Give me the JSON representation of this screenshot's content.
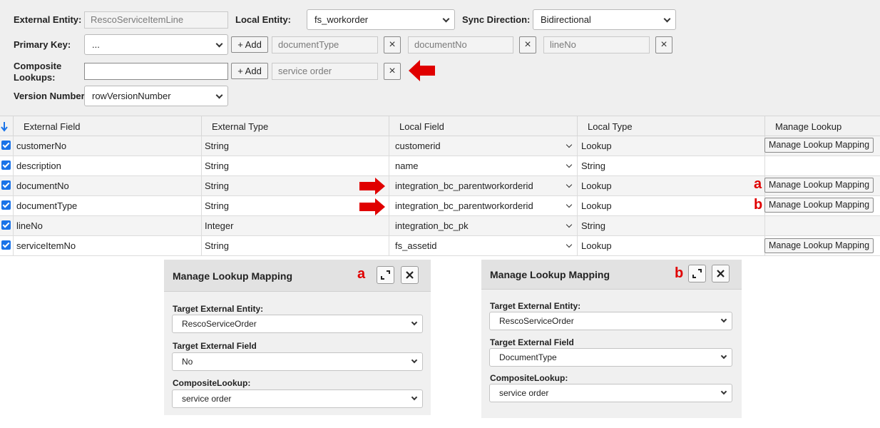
{
  "form": {
    "external_entity_label": "External Entity:",
    "external_entity_value": "RescoServiceItemLine",
    "local_entity_label": "Local Entity:",
    "local_entity_value": "fs_workorder",
    "sync_direction_label": "Sync Direction:",
    "sync_direction_value": "Bidirectional",
    "primary_key_label": "Primary Key:",
    "primary_key_value": "...",
    "add_label": "+ Add",
    "primary_keys": [
      "documentType",
      "documentNo",
      "lineNo"
    ],
    "composite_label_1": "Composite",
    "composite_label_2": "Lookups:",
    "composite_input_value": "",
    "composite_keys": [
      "service order"
    ],
    "version_number_label": "Version Number:",
    "version_number_value": "rowVersionNumber",
    "remove_glyph": "×"
  },
  "table": {
    "sort_icon": "sort-down-icon",
    "headers": [
      "External Field",
      "External Type",
      "Local Field",
      "Local Type",
      "Manage Lookup"
    ],
    "rows": [
      {
        "external_field": "customerNo",
        "external_type": "String",
        "local_field": "customerid",
        "local_type": "Lookup",
        "button": "Manage Lookup Mapping",
        "marker": ""
      },
      {
        "external_field": "description",
        "external_type": "String",
        "local_field": "name",
        "local_type": "String",
        "button": "",
        "marker": ""
      },
      {
        "external_field": "documentNo",
        "external_type": "String",
        "local_field": "integration_bc_parentworkorderid",
        "local_type": "Lookup",
        "button": "Manage Lookup Mapping",
        "marker": "a"
      },
      {
        "external_field": "documentType",
        "external_type": "String",
        "local_field": "integration_bc_parentworkorderid",
        "local_type": "Lookup",
        "button": "Manage Lookup Mapping",
        "marker": "b"
      },
      {
        "external_field": "lineNo",
        "external_type": "Integer",
        "local_field": "integration_bc_pk",
        "local_type": "String",
        "button": "",
        "marker": ""
      },
      {
        "external_field": "serviceItemNo",
        "external_type": "String",
        "local_field": "fs_assetid",
        "local_type": "Lookup",
        "button": "Manage Lookup Mapping",
        "marker": ""
      }
    ]
  },
  "dialogs": [
    {
      "marker": "a",
      "title": "Manage Lookup Mapping",
      "target_entity_label": "Target External Entity:",
      "target_entity_value": "RescoServiceOrder",
      "target_field_label": "Target External Field",
      "target_field_value": "No",
      "composite_label": "CompositeLookup:",
      "composite_value": "service order"
    },
    {
      "marker": "b",
      "title": "Manage Lookup Mapping",
      "target_entity_label": "Target External Entity:",
      "target_entity_value": "RescoServiceOrder",
      "target_field_label": "Target External Field",
      "target_field_value": "DocumentType",
      "composite_label": "CompositeLookup:",
      "composite_value": "service order"
    }
  ],
  "colors": {
    "annotation_red": "#e00000",
    "checkbox_blue": "#1a73e8",
    "panel_gray": "#efefef"
  }
}
